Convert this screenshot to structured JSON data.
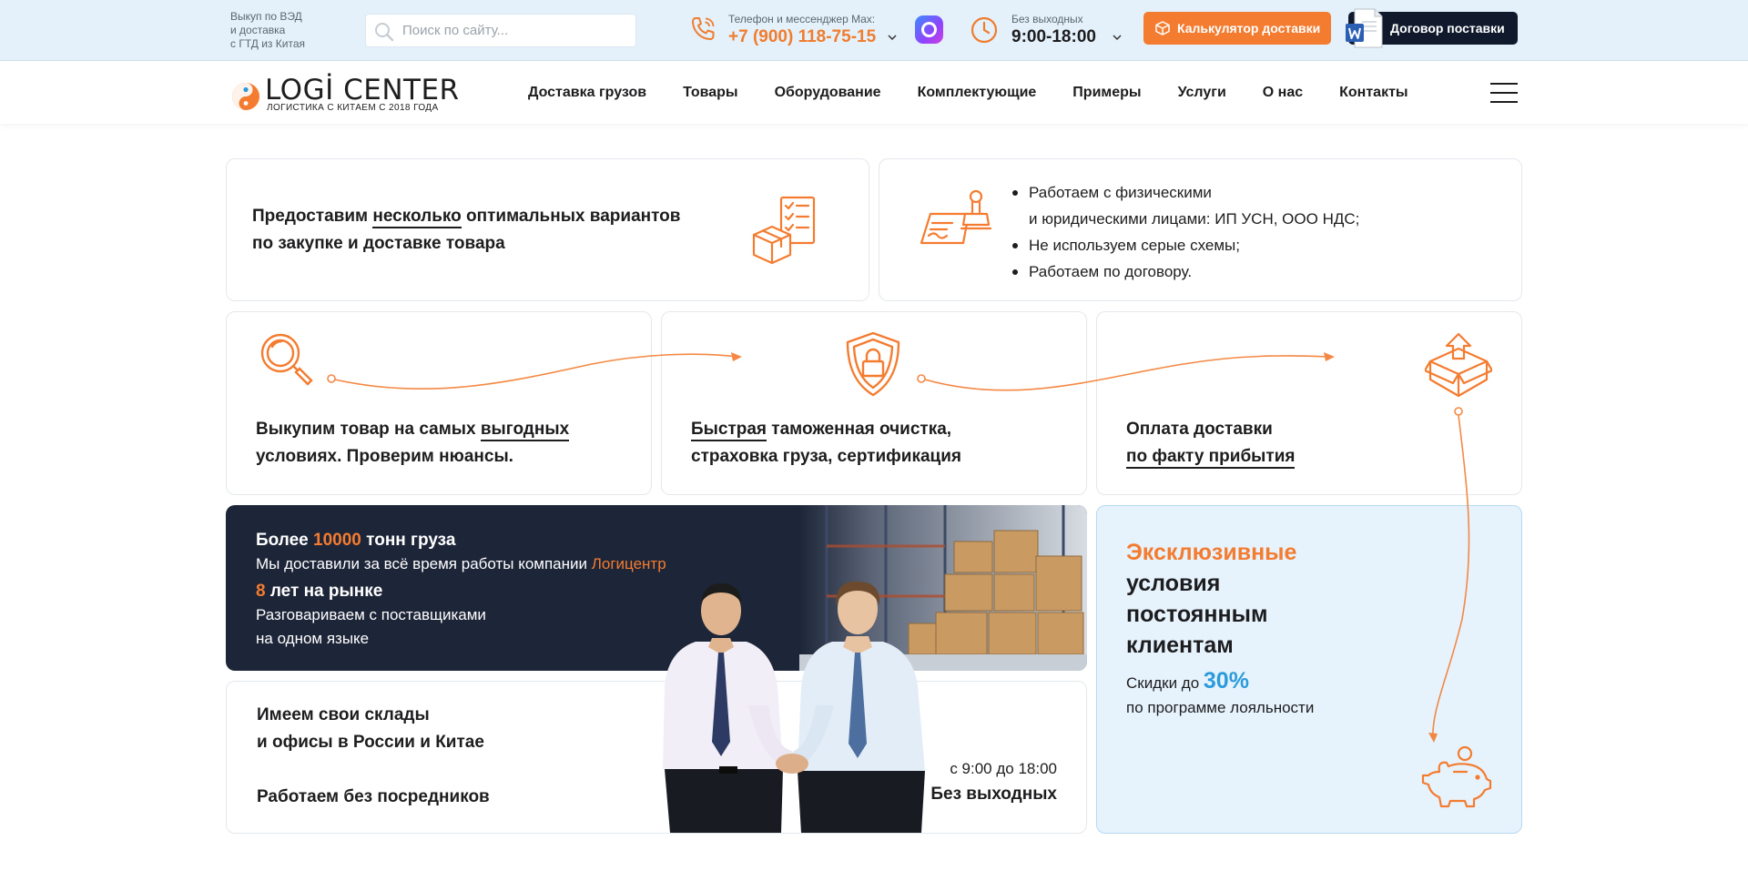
{
  "topbar": {
    "tagline": [
      "Выкуп по ВЭД",
      "и доставка",
      "с ГТД из Китая"
    ],
    "search_placeholder": "Поиск по сайту...",
    "phone_label": "Телефон и мессенджер Max:",
    "phone": "+7 (900) 118-75-15",
    "hours_label": "Без выходных",
    "hours": "9:00-18:00",
    "calc_button": "Калькулятор доставки",
    "contract_button": "Договор поставки",
    "colors": {
      "accent": "#f47c30",
      "dark": "#101a2c",
      "bar": "#e4f1fa"
    }
  },
  "logo": {
    "name": "LOGİ CENTER",
    "subtitle": "ЛОГИСТИКА С КИТАЕМ С 2018 ГОДА"
  },
  "nav": {
    "items": [
      "Доставка грузов",
      "Товары",
      "Оборудование",
      "Комплектующие",
      "Примеры",
      "Услуги",
      "О нас",
      "Контакты"
    ]
  },
  "cards": {
    "variants": {
      "line1_pre": "Предоставим ",
      "line1_ul": "несколько",
      "line1_post": " оптимальных вариантов",
      "line2": "по закупке и доставке товара"
    },
    "legal": [
      "Работаем с физическими",
      "и юридическими лицами: ИП УСН, ООО НДС;",
      "Не используем серые схемы;",
      "Работаем по договору."
    ],
    "buyout": {
      "line1_pre": "Выкупим товар на самых ",
      "line1_ul": "выгодных",
      "line2": "условиях. Проверим нюансы."
    },
    "customs": {
      "line1_ul": "Быстрая",
      "line1_post": " таможенная очистка,",
      "line2": "страховка груза, сертификация"
    },
    "payment": {
      "line1": "Оплата доставки",
      "line2_ul": "по факту прибытия"
    }
  },
  "stats": {
    "l1_pre": "Более ",
    "l1_num": "10000",
    "l1_post": " тонн груза",
    "l2_pre": "Мы доставили за всё время работы компании ",
    "l2_brand": "Логицентр",
    "l3_num": "8",
    "l3_post": " лет на рынке",
    "l4": "Разговариваем с поставщиками",
    "l5": "на одном языке"
  },
  "warehouses": {
    "line1": "Имеем свои склады",
    "line2": "и офисы в России и Китае",
    "line3": "Работаем без посредников",
    "time": "с 9:00 до 18:00",
    "days": "Без выходных"
  },
  "loyalty": {
    "title_accent": "Эксклюзивные",
    "title_rest": [
      "условия",
      "постоянным",
      "клиентам"
    ],
    "discount_pre": "Скидки до ",
    "discount_value": "30%",
    "discount_post": "по программе лояльности",
    "colors": {
      "accent": "#f47c30",
      "blue": "#2b9bdc"
    }
  }
}
